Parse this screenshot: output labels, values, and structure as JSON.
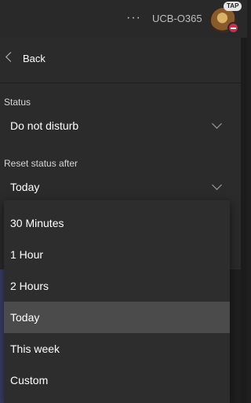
{
  "header": {
    "more_label": "···",
    "org_name": "UCB-O365",
    "tap_badge": "TAP",
    "presence": "do-not-disturb"
  },
  "panel": {
    "back_label": "Back",
    "status_label": "Status",
    "status_value": "Do not disturb",
    "reset_label": "Reset status after",
    "reset_value": "Today"
  },
  "dropdown": {
    "options": [
      "30 Minutes",
      "1 Hour",
      "2 Hours",
      "Today",
      "This week",
      "Custom"
    ],
    "selected": "Today"
  },
  "colors": {
    "background": "#1f1f1f",
    "panel": "#2b2b2b",
    "selected": "#4b4b4b",
    "dnd": "#c4314b"
  }
}
